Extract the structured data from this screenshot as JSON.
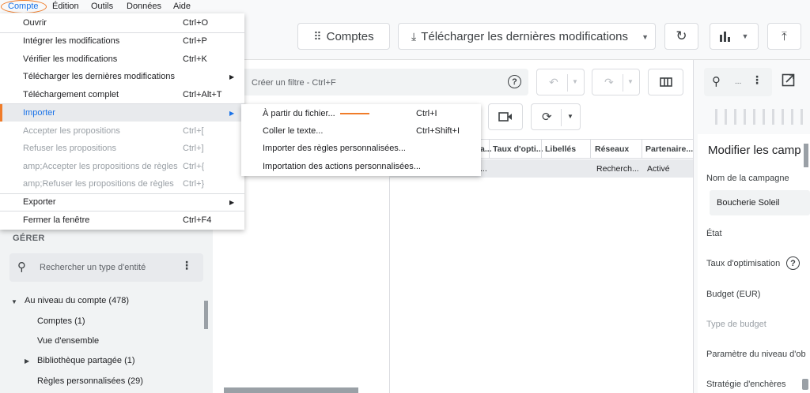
{
  "menubar": {
    "items": [
      "Compte",
      "Édition",
      "Outils",
      "Données",
      "Aide"
    ]
  },
  "toolbar": {
    "accounts_label": "Comptes",
    "download_label": "Télécharger les dernières modifications"
  },
  "account_menu": {
    "items": [
      {
        "label": "Ouvrir",
        "shortcut": "Ctrl+O"
      },
      {
        "label": "Intégrer les modifications",
        "shortcut": "Ctrl+P"
      },
      {
        "label": "Vérifier les modifications",
        "shortcut": "Ctrl+K"
      },
      {
        "label": "Télécharger les dernières modifications",
        "shortcut": ""
      },
      {
        "label": "Téléchargement complet",
        "shortcut": "Ctrl+Alt+T"
      },
      {
        "label": "Importer",
        "shortcut": ""
      },
      {
        "label": "Accepter les propositions",
        "shortcut": "Ctrl+["
      },
      {
        "label": "Refuser les propositions",
        "shortcut": "Ctrl+]"
      },
      {
        "label": "amp;Accepter les propositions de règles",
        "shortcut": "Ctrl+{"
      },
      {
        "label": "amp;Refuser les propositions de règles",
        "shortcut": "Ctrl+}"
      },
      {
        "label": "Exporter",
        "shortcut": ""
      },
      {
        "label": "Fermer la fenêtre",
        "shortcut": "Ctrl+F4"
      }
    ]
  },
  "import_submenu": {
    "items": [
      {
        "label": "À partir du fichier...",
        "shortcut": "Ctrl+I"
      },
      {
        "label": "Coller le texte...",
        "shortcut": "Ctrl+Shift+I"
      },
      {
        "label": "Importer des règles personnalisées...",
        "shortcut": ""
      },
      {
        "label": "Importation des actions personnalisées...",
        "shortcut": ""
      }
    ]
  },
  "filter": {
    "placeholder": "Créer un filtre - Ctrl+F"
  },
  "sidebar": {
    "section": "GÉRER",
    "search_placeholder": "Rechercher un type d'entité",
    "tree": [
      "Au niveau du compte (478)",
      "Comptes (1)",
      "Vue d'ensemble",
      "Bibliothèque partagée (1)",
      "Règles personnalisées (29)"
    ]
  },
  "grid": {
    "headers": [
      "a...",
      "Taux d'opti...",
      "Libellés",
      "Réseaux",
      "Partenaire..."
    ],
    "row": [
      "...",
      "Recherch...",
      "Activé"
    ]
  },
  "edit_panel": {
    "title": "Modifier les camp",
    "campaign_name_label": "Nom de la campagne",
    "campaign_name_value": "Boucherie Soleil",
    "fields": [
      "État",
      "Taux d'optimisation",
      "Budget (EUR)",
      "Type de budget",
      "Paramètre du niveau d'ob",
      "Stratégie d'enchères"
    ],
    "search_ellipsis": "..."
  },
  "colors": {
    "accent": "#1a73e8",
    "annotation": "#f07c2a",
    "menu_bg": "#ffffff",
    "panel_bg": "#f1f3f4"
  }
}
